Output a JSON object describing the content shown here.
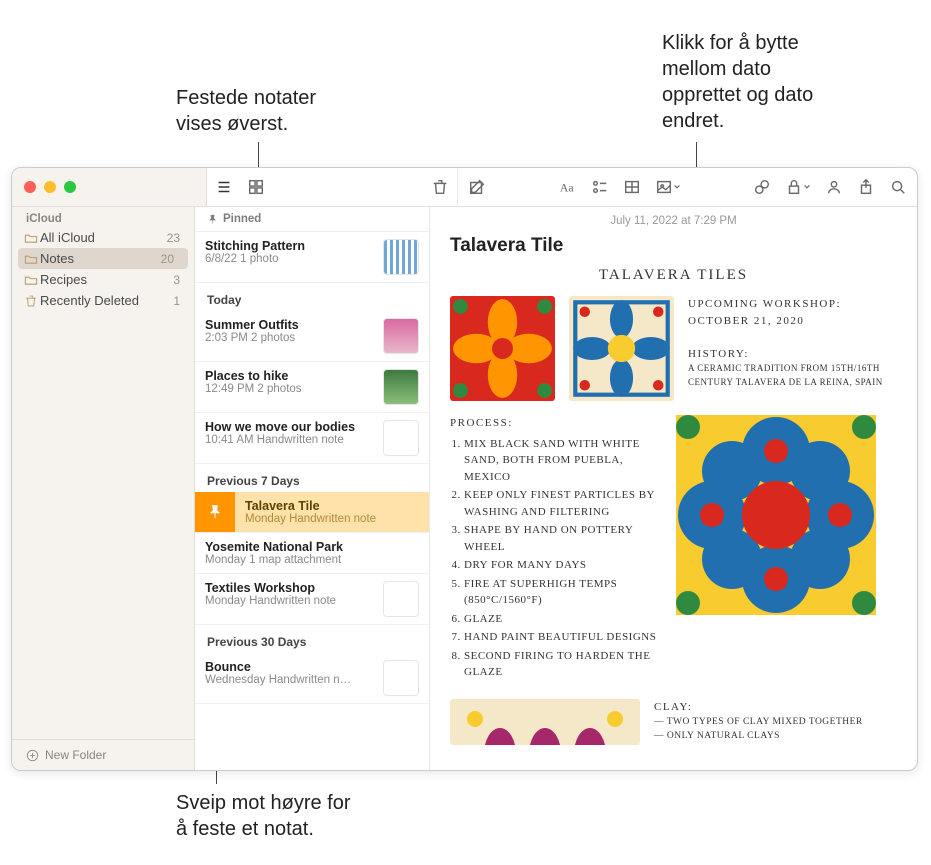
{
  "callouts": {
    "top_left": "Festede notater\nvises øverst.",
    "top_right": "Klikk for å bytte\nmellom dato\nopprettet og dato\nendret.",
    "bottom": "Sveip mot høyre for\nå feste et notat."
  },
  "sidebar": {
    "section": "iCloud",
    "items": [
      {
        "name": "All iCloud",
        "count": "23"
      },
      {
        "name": "Notes",
        "count": "20"
      },
      {
        "name": "Recipes",
        "count": "3"
      },
      {
        "name": "Recently Deleted",
        "count": "1"
      }
    ],
    "new_folder": "New Folder"
  },
  "list": {
    "pinned_label": "Pinned",
    "pinned": [
      {
        "title": "Stitching Pattern",
        "sub": "6/8/22  1 photo"
      }
    ],
    "sections": [
      {
        "header": "Today",
        "items": [
          {
            "title": "Summer Outfits",
            "sub": "2:03 PM  2 photos"
          },
          {
            "title": "Places to hike",
            "sub": "12:49 PM  2 photos"
          },
          {
            "title": "How we move our bodies",
            "sub": "10:41 AM  Handwritten note"
          }
        ]
      },
      {
        "header": "Previous 7 Days",
        "selected": {
          "title": "Talavera Tile",
          "sub": "Monday  Handwritten note"
        },
        "items": [
          {
            "title": "Yosemite National Park",
            "sub": "Monday  1 map attachment"
          },
          {
            "title": "Textiles Workshop",
            "sub": "Monday  Handwritten note"
          }
        ]
      },
      {
        "header": "Previous 30 Days",
        "items": [
          {
            "title": "Bounce",
            "sub": "Wednesday  Handwritten n…"
          }
        ]
      }
    ]
  },
  "editor": {
    "date": "July 11, 2022 at 7:29 PM",
    "title": "Talavera Tile",
    "hand_title": "TALAVERA TILES",
    "upcoming_h": "UPCOMING WORKSHOP:",
    "upcoming_d": "OCTOBER 21, 2020",
    "history_h": "HISTORY:",
    "history_t": "A CERAMIC TRADITION FROM 15TH/16TH CENTURY TALAVERA DE LA REINA, SPAIN",
    "process_h": "PROCESS:",
    "process": [
      "MIX BLACK SAND WITH WHITE SAND, BOTH FROM PUEBLA, MEXICO",
      "KEEP ONLY FINEST PARTICLES BY WASHING AND FILTERING",
      "SHAPE BY HAND ON POTTERY WHEEL",
      "DRY FOR MANY DAYS",
      "FIRE AT SUPERHIGH TEMPS (850°C/1560°F)",
      "GLAZE",
      "HAND PAINT BEAUTIFUL DESIGNS",
      "SECOND FIRING TO HARDEN THE GLAZE"
    ],
    "clay_h": "CLAY:",
    "clay_1": "— TWO TYPES OF CLAY MIXED TOGETHER",
    "clay_2": "— ONLY NATURAL CLAYS"
  },
  "colors": {
    "orange": "#ff9500",
    "red": "#d9291f",
    "blue": "#226fb0",
    "yellow": "#f8cb2f",
    "green": "#2f8a3f",
    "cream": "#f5e8c8",
    "magenta": "#a6286a"
  }
}
